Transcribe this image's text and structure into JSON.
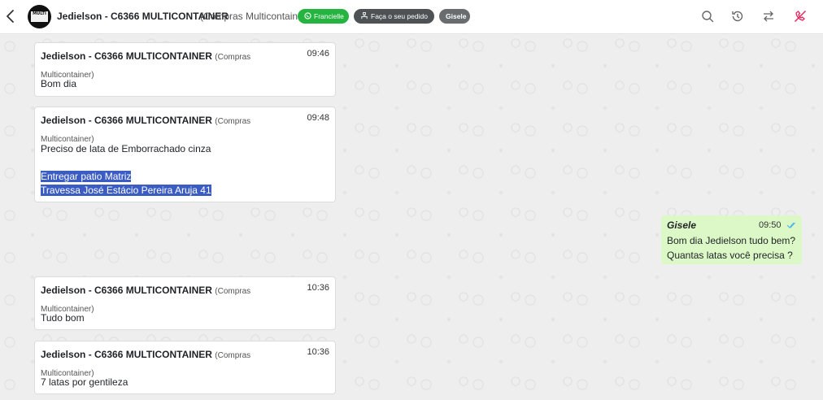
{
  "header": {
    "title": "Jedielson - C6366 MULTICONTAINER",
    "subtitle": "(Compras Multicontainer)",
    "avatar_text": "MULTI",
    "agent_pill": "Francielle",
    "order_pill": "Faça o seu pedido",
    "user_pill": "Gisele",
    "icons": [
      "chevron-left-icon",
      "search-icon",
      "history-icon",
      "transfer-icon",
      "phone-off-icon"
    ]
  },
  "messages": [
    {
      "sender": "Jedielson - C6366 MULTICONTAINER",
      "group": "(Compras Multicontainer)",
      "time": "09:46",
      "lines": [
        "Bom dia"
      ]
    },
    {
      "sender": "Jedielson - C6366 MULTICONTAINER",
      "group": "(Compras Multicontainer)",
      "time": "09:48",
      "lines": [
        "Preciso de lata de Emborrachado cinza"
      ],
      "selected_lines": [
        "Entregar patio Matriz",
        "Travessa José Estácio Pereira Aruja 41"
      ]
    },
    {
      "sender": "Gisele",
      "time": "09:50",
      "lines": [
        "Bom dia Jedielson tudo bem?",
        "Quantas latas você precisa ?"
      ],
      "outgoing": true
    },
    {
      "sender": "Jedielson - C6366 MULTICONTAINER",
      "group": "(Compras Multicontainer)",
      "time": "10:36",
      "lines": [
        "Tudo bom"
      ]
    },
    {
      "sender": "Jedielson - C6366 MULTICONTAINER",
      "group": "(Compras Multicontainer)",
      "time": "10:36",
      "lines": [
        "7 latas por gentileza"
      ]
    }
  ],
  "colors": {
    "agent_pill": "#25b440",
    "outgoing_bubble": "#dcf8c6",
    "selection": "#3b5dc3",
    "hangup_icon": "#e0245e",
    "read_ticks": "#4fb6ec"
  }
}
